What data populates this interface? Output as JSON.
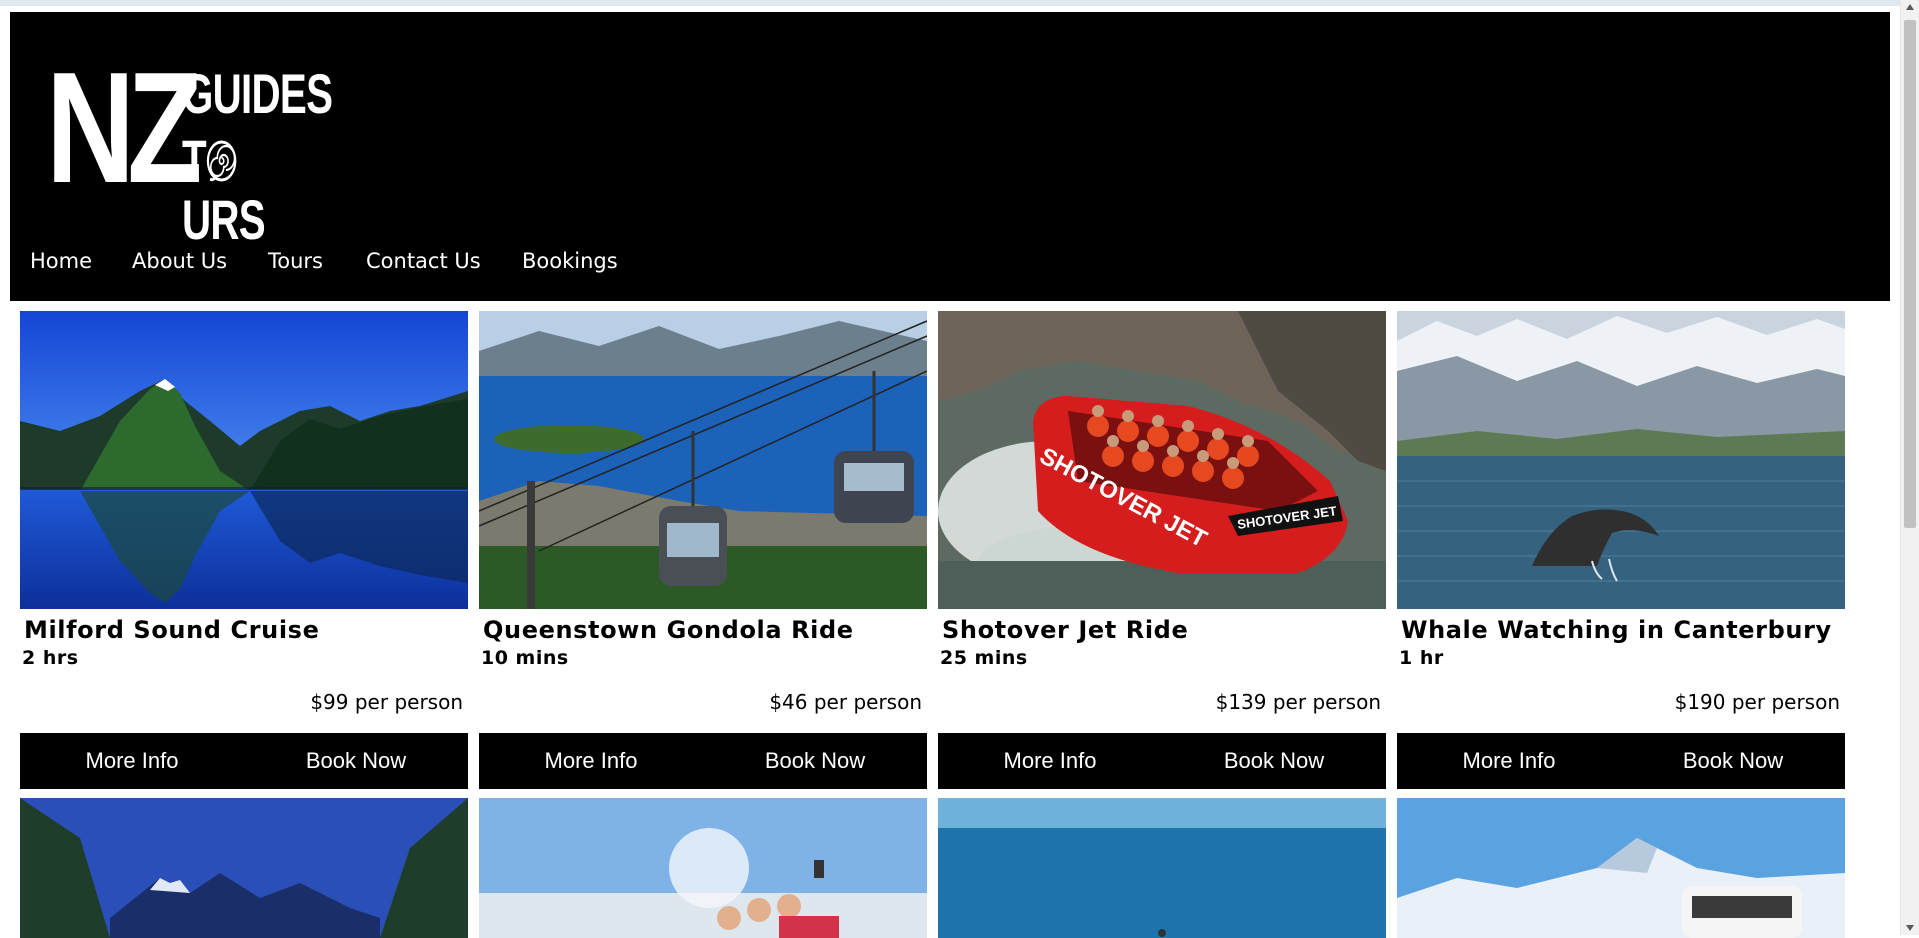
{
  "site": {
    "logo": {
      "big": "NZ",
      "line1": "GUIDES",
      "line2_prefix": "T",
      "line2_suffix": "URS"
    }
  },
  "nav": {
    "items": [
      {
        "label": "Home"
      },
      {
        "label": "About Us"
      },
      {
        "label": "Tours"
      },
      {
        "label": "Contact Us"
      },
      {
        "label": "Bookings"
      }
    ]
  },
  "tours": [
    {
      "title": "Milford Sound Cruise",
      "duration": "2 hrs",
      "price": "$99 per person",
      "more_label": "More Info",
      "book_label": "Book Now"
    },
    {
      "title": "Queenstown Gondola Ride",
      "duration": "10 mins",
      "price": "$46 per person",
      "more_label": "More Info",
      "book_label": "Book Now"
    },
    {
      "title": "Shotover Jet Ride",
      "duration": "25 mins",
      "price": "$139 per person",
      "more_label": "More Info",
      "book_label": "Book Now"
    },
    {
      "title": "Whale Watching in Canterbury",
      "duration": "1 hr",
      "price": "$190 per person",
      "more_label": "More Info",
      "book_label": "Book Now"
    }
  ],
  "jet_boat_text": {
    "side": "SHOTOVER JET",
    "plate": "SHOTOVER JET"
  },
  "colors": {
    "header_bg": "#000000",
    "button_bg": "#000000",
    "text": "#000000",
    "header_text": "#ffffff"
  }
}
